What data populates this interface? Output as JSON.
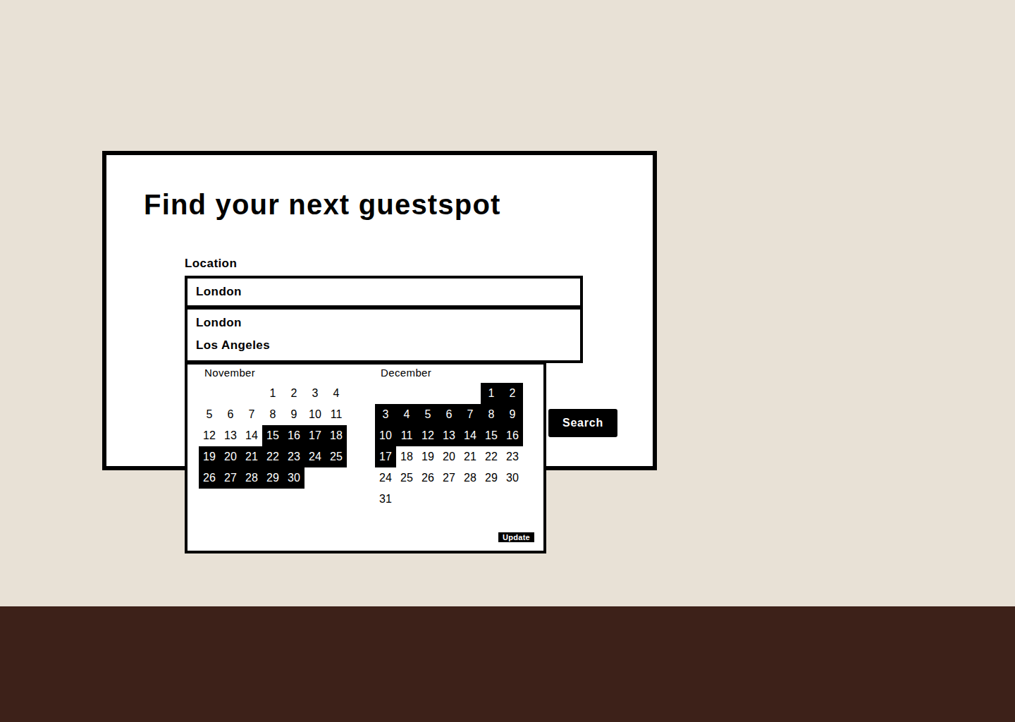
{
  "card": {
    "title": "Find your next guestspot",
    "location": {
      "label": "Location",
      "value": "London",
      "suggestions": [
        "London",
        "Los Angeles"
      ]
    },
    "calendar": {
      "months": [
        {
          "name": "November",
          "days": [
            {
              "day": "1",
              "selected": false
            },
            {
              "day": "2",
              "selected": false
            },
            {
              "day": "3",
              "selected": false
            },
            {
              "day": "4",
              "selected": false
            },
            {
              "day": "5",
              "selected": false
            },
            {
              "day": "6",
              "selected": false
            },
            {
              "day": "7",
              "selected": false
            },
            {
              "day": "8",
              "selected": false
            },
            {
              "day": "9",
              "selected": false
            },
            {
              "day": "10",
              "selected": false
            },
            {
              "day": "11",
              "selected": false
            },
            {
              "day": "12",
              "selected": false
            },
            {
              "day": "13",
              "selected": false
            },
            {
              "day": "14",
              "selected": false
            },
            {
              "day": "15",
              "selected": true
            },
            {
              "day": "16",
              "selected": true
            },
            {
              "day": "17",
              "selected": true
            },
            {
              "day": "18",
              "selected": true
            },
            {
              "day": "19",
              "selected": true
            },
            {
              "day": "20",
              "selected": true
            },
            {
              "day": "21",
              "selected": true
            },
            {
              "day": "22",
              "selected": true
            },
            {
              "day": "23",
              "selected": true
            },
            {
              "day": "24",
              "selected": true
            },
            {
              "day": "25",
              "selected": true
            },
            {
              "day": "26",
              "selected": true
            },
            {
              "day": "27",
              "selected": true
            },
            {
              "day": "28",
              "selected": true
            },
            {
              "day": "29",
              "selected": true
            },
            {
              "day": "30",
              "selected": true
            }
          ]
        },
        {
          "name": "December",
          "days": [
            {
              "day": "1",
              "selected": true
            },
            {
              "day": "2",
              "selected": true
            },
            {
              "day": "3",
              "selected": true
            },
            {
              "day": "4",
              "selected": true
            },
            {
              "day": "5",
              "selected": true
            },
            {
              "day": "6",
              "selected": true
            },
            {
              "day": "7",
              "selected": true
            },
            {
              "day": "8",
              "selected": true
            },
            {
              "day": "9",
              "selected": true
            },
            {
              "day": "10",
              "selected": true
            },
            {
              "day": "11",
              "selected": true
            },
            {
              "day": "12",
              "selected": true
            },
            {
              "day": "13",
              "selected": true
            },
            {
              "day": "14",
              "selected": true
            },
            {
              "day": "15",
              "selected": true
            },
            {
              "day": "16",
              "selected": true
            },
            {
              "day": "17",
              "selected": true
            },
            {
              "day": "18",
              "selected": false
            },
            {
              "day": "19",
              "selected": false
            },
            {
              "day": "20",
              "selected": false
            },
            {
              "day": "21",
              "selected": false
            },
            {
              "day": "22",
              "selected": false
            },
            {
              "day": "23",
              "selected": false
            },
            {
              "day": "24",
              "selected": false
            },
            {
              "day": "25",
              "selected": false
            },
            {
              "day": "26",
              "selected": false
            },
            {
              "day": "27",
              "selected": false
            },
            {
              "day": "28",
              "selected": false
            },
            {
              "day": "29",
              "selected": false
            },
            {
              "day": "30",
              "selected": false
            },
            {
              "day": "31",
              "selected": false
            }
          ]
        }
      ],
      "update_button": "Update"
    },
    "search_button": "Search"
  }
}
